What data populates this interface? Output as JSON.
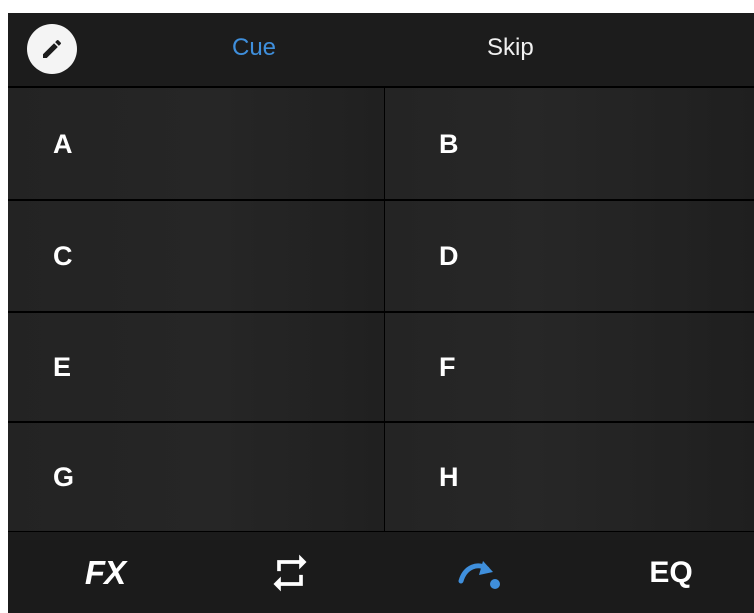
{
  "header": {
    "tabs": [
      {
        "label": "Cue",
        "active": true
      },
      {
        "label": "Skip",
        "active": false
      }
    ],
    "edit_icon": "pencil-icon"
  },
  "pads": [
    {
      "label": "A"
    },
    {
      "label": "B"
    },
    {
      "label": "C"
    },
    {
      "label": "D"
    },
    {
      "label": "E"
    },
    {
      "label": "F"
    },
    {
      "label": "G"
    },
    {
      "label": "H"
    }
  ],
  "toolbar": {
    "fx_label": "FX",
    "loop_icon": "loop-icon",
    "skip_icon": "skip-forward-icon",
    "eq_label": "EQ"
  },
  "colors": {
    "accent": "#3f8fdc",
    "background": "#1b1b1b",
    "text": "#ffffff"
  }
}
